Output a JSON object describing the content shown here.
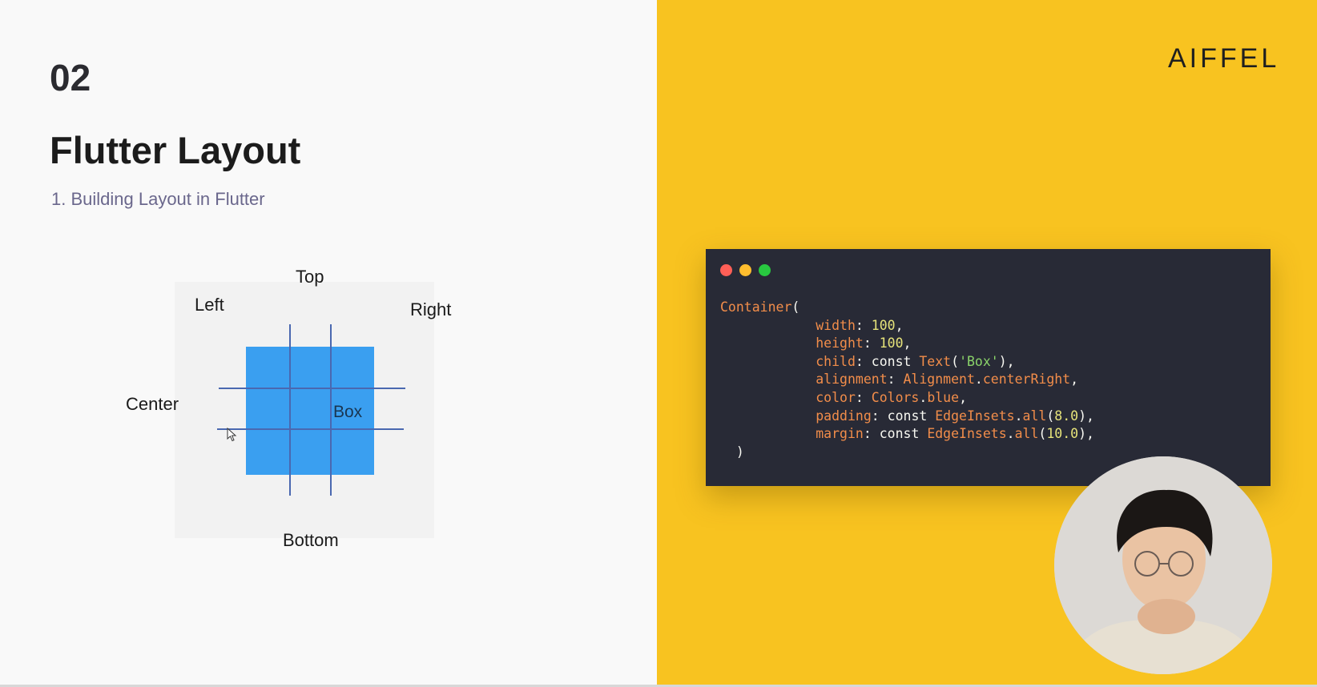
{
  "slide": {
    "section_number": "02",
    "title": "Flutter Layout",
    "subtitle": "1. Building Layout in Flutter"
  },
  "diagram": {
    "labels": {
      "top": "Top",
      "left": "Left",
      "right": "Right",
      "center": "Center",
      "bottom": "Bottom"
    },
    "box_text": "Box",
    "box_color": "#3a9ff0",
    "guide_color": "#4a68b0"
  },
  "brand": {
    "logo_text": "AIFFEL"
  },
  "code_window": {
    "lines": [
      {
        "indent": "",
        "tokens": [
          {
            "t": "Container",
            "c": "class"
          },
          {
            "t": "(",
            "c": "punc"
          }
        ]
      },
      {
        "indent": "            ",
        "tokens": [
          {
            "t": "width",
            "c": "prop"
          },
          {
            "t": ": ",
            "c": "punc"
          },
          {
            "t": "100",
            "c": "num"
          },
          {
            "t": ",",
            "c": "punc"
          }
        ]
      },
      {
        "indent": "            ",
        "tokens": [
          {
            "t": "height",
            "c": "prop"
          },
          {
            "t": ": ",
            "c": "punc"
          },
          {
            "t": "100",
            "c": "num"
          },
          {
            "t": ",",
            "c": "punc"
          }
        ]
      },
      {
        "indent": "            ",
        "tokens": [
          {
            "t": "child",
            "c": "prop"
          },
          {
            "t": ": ",
            "c": "punc"
          },
          {
            "t": "const ",
            "c": "kw"
          },
          {
            "t": "Text",
            "c": "class"
          },
          {
            "t": "(",
            "c": "punc"
          },
          {
            "t": "'Box'",
            "c": "str"
          },
          {
            "t": "),",
            "c": "punc"
          }
        ]
      },
      {
        "indent": "            ",
        "tokens": [
          {
            "t": "alignment",
            "c": "prop"
          },
          {
            "t": ": ",
            "c": "punc"
          },
          {
            "t": "Alignment",
            "c": "class"
          },
          {
            "t": ".",
            "c": "punc"
          },
          {
            "t": "centerRight",
            "c": "prop"
          },
          {
            "t": ",",
            "c": "punc"
          }
        ]
      },
      {
        "indent": "            ",
        "tokens": [
          {
            "t": "color",
            "c": "prop"
          },
          {
            "t": ": ",
            "c": "punc"
          },
          {
            "t": "Colors",
            "c": "class"
          },
          {
            "t": ".",
            "c": "punc"
          },
          {
            "t": "blue",
            "c": "prop"
          },
          {
            "t": ",",
            "c": "punc"
          }
        ]
      },
      {
        "indent": "            ",
        "tokens": [
          {
            "t": "padding",
            "c": "prop"
          },
          {
            "t": ": ",
            "c": "punc"
          },
          {
            "t": "const ",
            "c": "kw"
          },
          {
            "t": "EdgeInsets",
            "c": "class"
          },
          {
            "t": ".",
            "c": "punc"
          },
          {
            "t": "all",
            "c": "prop"
          },
          {
            "t": "(",
            "c": "punc"
          },
          {
            "t": "8.0",
            "c": "num"
          },
          {
            "t": "),",
            "c": "punc"
          }
        ]
      },
      {
        "indent": "            ",
        "tokens": [
          {
            "t": "margin",
            "c": "prop"
          },
          {
            "t": ": ",
            "c": "punc"
          },
          {
            "t": "const ",
            "c": "kw"
          },
          {
            "t": "EdgeInsets",
            "c": "class"
          },
          {
            "t": ".",
            "c": "punc"
          },
          {
            "t": "all",
            "c": "prop"
          },
          {
            "t": "(",
            "c": "punc"
          },
          {
            "t": "10.0",
            "c": "num"
          },
          {
            "t": "),",
            "c": "punc"
          }
        ]
      },
      {
        "indent": "  ",
        "tokens": [
          {
            "t": ")",
            "c": "punc"
          }
        ]
      }
    ]
  },
  "colors": {
    "accent_yellow": "#f8c320",
    "code_background": "#282a36"
  }
}
